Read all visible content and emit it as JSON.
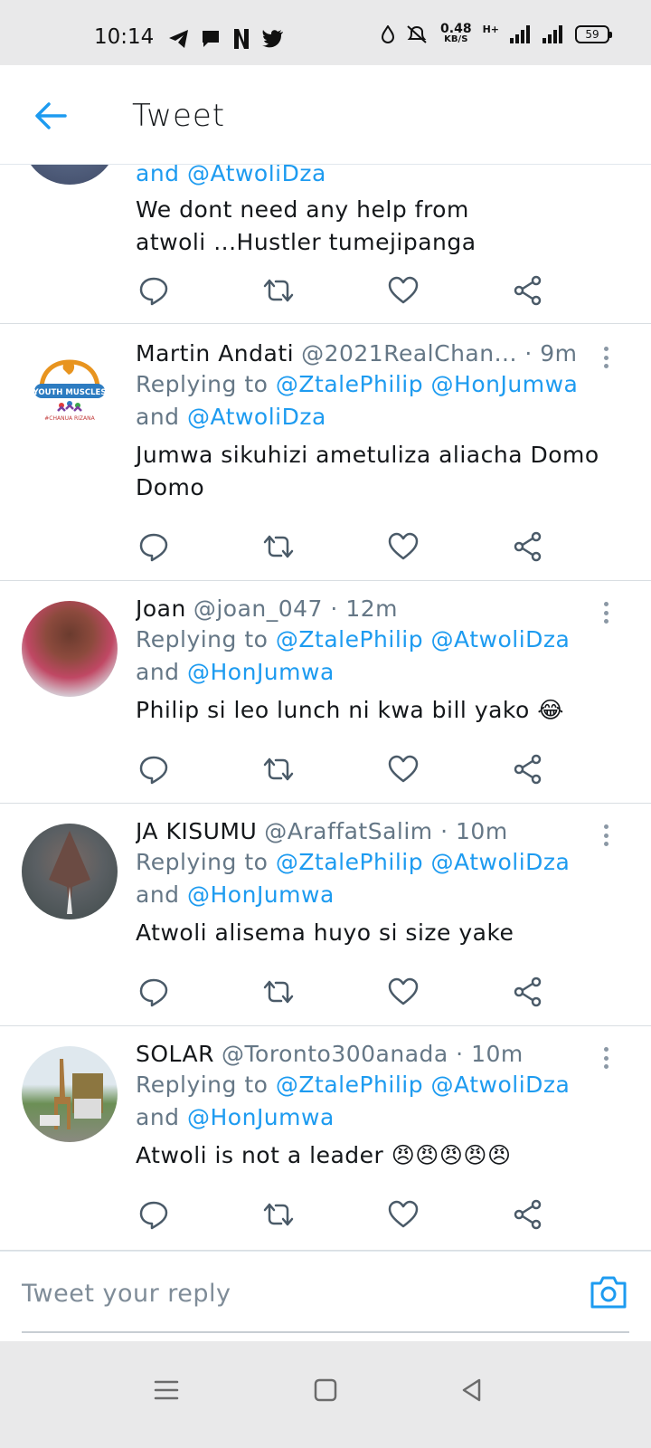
{
  "status_bar": {
    "time": "10:14",
    "speed_value": "0.48",
    "speed_unit": "KB/S",
    "network_type": "H+",
    "battery": "59"
  },
  "header": {
    "title": "Tweet"
  },
  "partial_tweet": {
    "reply_tail": "and @AtwoliDza",
    "text_line1": "We dont need any help from",
    "text_line2": "atwoli ...Hustler tumejipanga"
  },
  "tweets": [
    {
      "name": "Martin Andati",
      "handle": "@2021RealChan...",
      "time": "· 9m",
      "replying_prefix": "Replying to",
      "reply_mentions_line1": "@ZtalePhilip @HonJumwa",
      "reply_and": "and",
      "reply_mentions_line2": "@AtwoliDza",
      "text_line1": "Jumwa sikuhizi ametuliza aliacha Domo",
      "text_line2": "Domo"
    },
    {
      "name": "Joan",
      "handle": "@joan_047",
      "time": "· 12m",
      "replying_prefix": "Replying to",
      "reply_mentions_line1": "@ZtalePhilip @AtwoliDza",
      "reply_and": "and",
      "reply_mentions_line2": "@HonJumwa",
      "text_line1": "Philip si leo lunch ni kwa bill yako 😂"
    },
    {
      "name": "JA KISUMU",
      "handle": "@AraffatSalim",
      "time": "· 10m",
      "replying_prefix": "Replying to",
      "reply_mentions_line1": "@ZtalePhilip @AtwoliDza",
      "reply_and": "and",
      "reply_mentions_line2": "@HonJumwa",
      "text_line1": "Atwoli alisema huyo si size yake"
    },
    {
      "name": "SOLAR",
      "handle": "@Toronto300anada",
      "time": "· 10m",
      "replying_prefix": "Replying to",
      "reply_mentions_line1": "@ZtalePhilip @AtwoliDza",
      "reply_and": "and",
      "reply_mentions_line2": "@HonJumwa",
      "text_line1": "Atwoli is not a leader 😠😠😠😠😠"
    }
  ],
  "avatars": {
    "martin_logo_text": "YOUTH MUSCLES",
    "martin_logo_subtext": "#CHANUA RIZANA"
  },
  "reply_bar": {
    "placeholder": "Tweet your reply"
  },
  "colors": {
    "accent": "#1d9bf0",
    "text_primary": "#14171a",
    "text_secondary": "#657786",
    "icon_gray": "#4a5a68"
  }
}
